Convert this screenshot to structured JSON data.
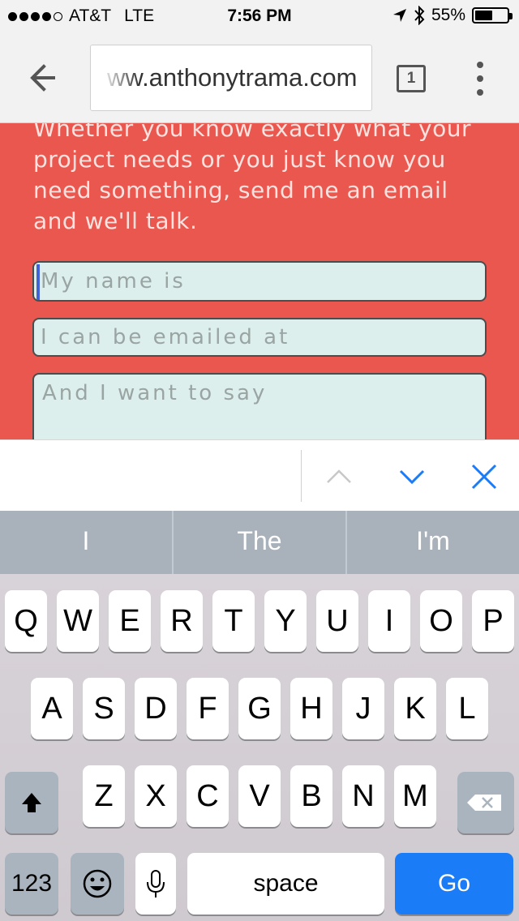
{
  "status_bar": {
    "carrier": "AT&T",
    "network": "LTE",
    "time": "7:56 PM",
    "battery_percent": "55%",
    "battery_level": 0.55,
    "signal_bars": 4,
    "icons": [
      "location-arrow-icon",
      "bluetooth-icon",
      "battery-icon"
    ]
  },
  "browser": {
    "url": "ww.anthonytrama.com",
    "tab_count": "1",
    "icons": [
      "back-arrow-icon",
      "tab-switcher-icon",
      "overflow-menu-icon"
    ]
  },
  "page": {
    "intro_lines": [
      "Whether you know exactly what your",
      "project needs or you just know you",
      "need something, send me an email",
      "and we'll talk."
    ],
    "form": {
      "name_placeholder": "My name is",
      "email_placeholder": "I can be emailed at",
      "message_placeholder": "And I want to say"
    },
    "colors": {
      "background": "#e9574f",
      "field": "#dcefec",
      "text": "#fbe2df"
    }
  },
  "form_assistant": {
    "icons": [
      "chevron-up-icon",
      "chevron-down-icon",
      "close-icon"
    ]
  },
  "keyboard": {
    "suggestions": [
      "I",
      "The",
      "I'm"
    ],
    "row1": [
      "Q",
      "W",
      "E",
      "R",
      "T",
      "Y",
      "U",
      "I",
      "O",
      "P"
    ],
    "row2": [
      "A",
      "S",
      "D",
      "F",
      "G",
      "H",
      "J",
      "K",
      "L"
    ],
    "row3": [
      "Z",
      "X",
      "C",
      "V",
      "B",
      "N",
      "M"
    ],
    "numbers_label": "123",
    "space_label": "space",
    "go_label": "Go",
    "icons": [
      "shift-icon",
      "delete-icon",
      "emoji-icon",
      "microphone-icon"
    ],
    "colors": {
      "go": "#1a7cf6"
    }
  }
}
